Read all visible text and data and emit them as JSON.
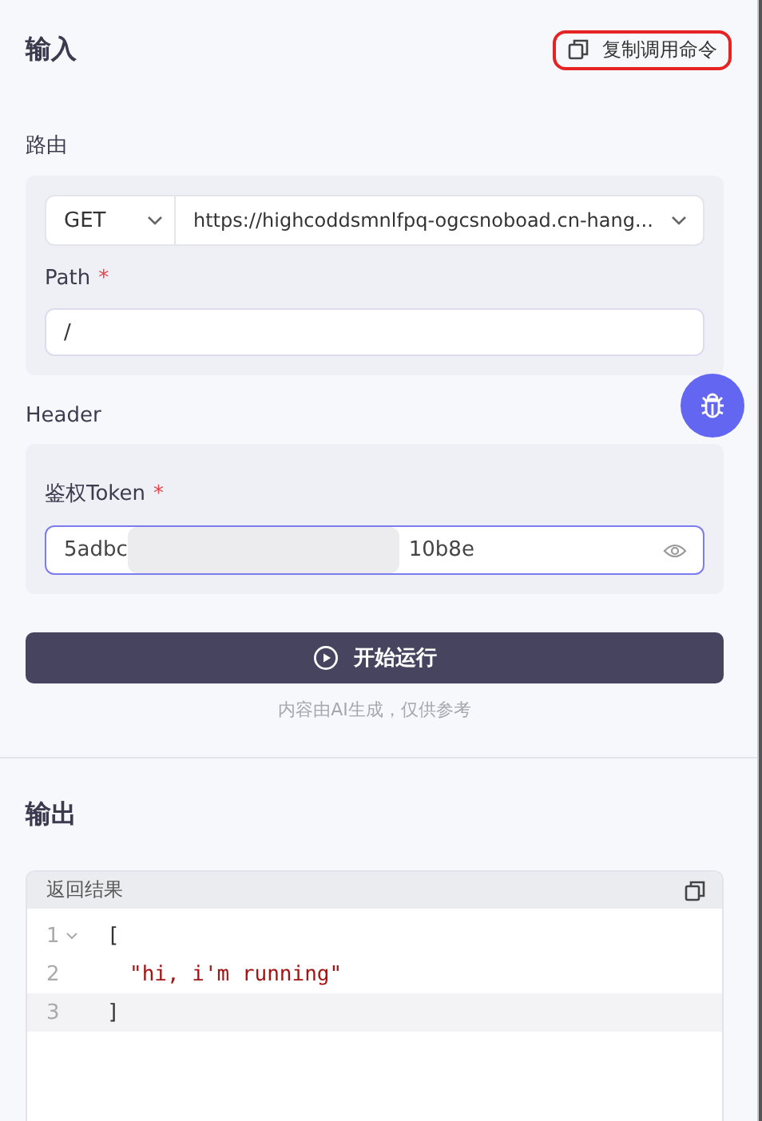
{
  "input_section": {
    "title": "输入",
    "copy_command": {
      "label": "复制调用命令",
      "highlighted": true
    }
  },
  "route": {
    "label": "路由",
    "method": "GET",
    "url": "https://highcoddsmnlfpq-ogcsnoboad.cn-hang...",
    "path": {
      "label": "Path",
      "required_mark": "*",
      "value": "/"
    }
  },
  "header": {
    "label": "Header",
    "token": {
      "label": "鉴权Token",
      "required_mark": "*",
      "value_start": "5adbc",
      "value_end": "10b8e",
      "redacted": true,
      "focused": true
    }
  },
  "run_button": {
    "label": "开始运行"
  },
  "disclaimer": "内容由AI生成，仅供参考",
  "output_section": {
    "title": "输出",
    "result": {
      "title": "返回结果",
      "lines": [
        {
          "number": "1",
          "foldable": true,
          "highlighted": false,
          "parts": [
            {
              "kind": "punct",
              "text": "["
            }
          ]
        },
        {
          "number": "2",
          "highlighted": false,
          "parts": [
            {
              "kind": "string",
              "text": "\"hi, i'm running\""
            }
          ],
          "indent": true
        },
        {
          "number": "3",
          "highlighted": true,
          "parts": [
            {
              "kind": "punct",
              "text": "]"
            }
          ]
        }
      ]
    }
  }
}
